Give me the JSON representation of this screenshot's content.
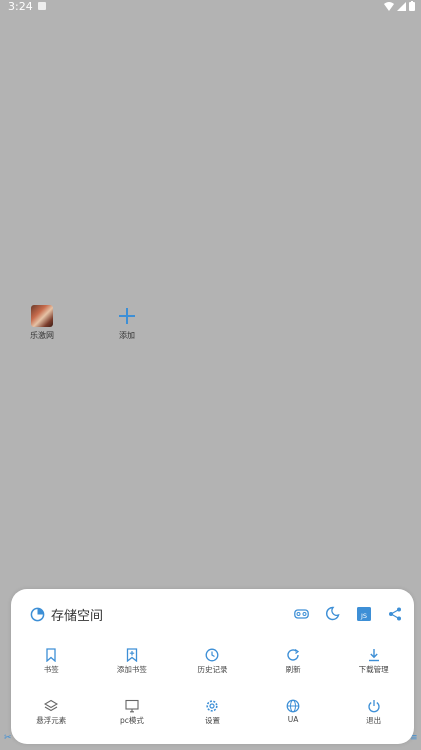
{
  "status_bar": {
    "time": "3:24"
  },
  "shortcuts": [
    {
      "label": "乐激网",
      "icon": "site-thumbnail"
    },
    {
      "label": "添加",
      "icon": "plus-icon"
    }
  ],
  "menu": {
    "title": "存储空间",
    "header_icons": [
      "vr-glasses-icon",
      "night-mode-icon",
      "js-icon",
      "share-icon"
    ],
    "row1": [
      {
        "label": "书签",
        "icon": "bookmark-icon"
      },
      {
        "label": "添加书签",
        "icon": "add-bookmark-icon"
      },
      {
        "label": "历史记录",
        "icon": "history-icon"
      },
      {
        "label": "刷新",
        "icon": "refresh-icon"
      },
      {
        "label": "下载管理",
        "icon": "download-icon"
      }
    ],
    "row2": [
      {
        "label": "悬浮元素",
        "icon": "layers-icon"
      },
      {
        "label": "pc模式",
        "icon": "monitor-icon"
      },
      {
        "label": "设置",
        "icon": "settings-icon"
      },
      {
        "label": "UA",
        "icon": "globe-icon"
      },
      {
        "label": "退出",
        "icon": "power-icon"
      }
    ]
  },
  "colors": {
    "accent": "#3d8fd6",
    "overlay": "#b3b3b3",
    "sheet": "#ffffff"
  }
}
